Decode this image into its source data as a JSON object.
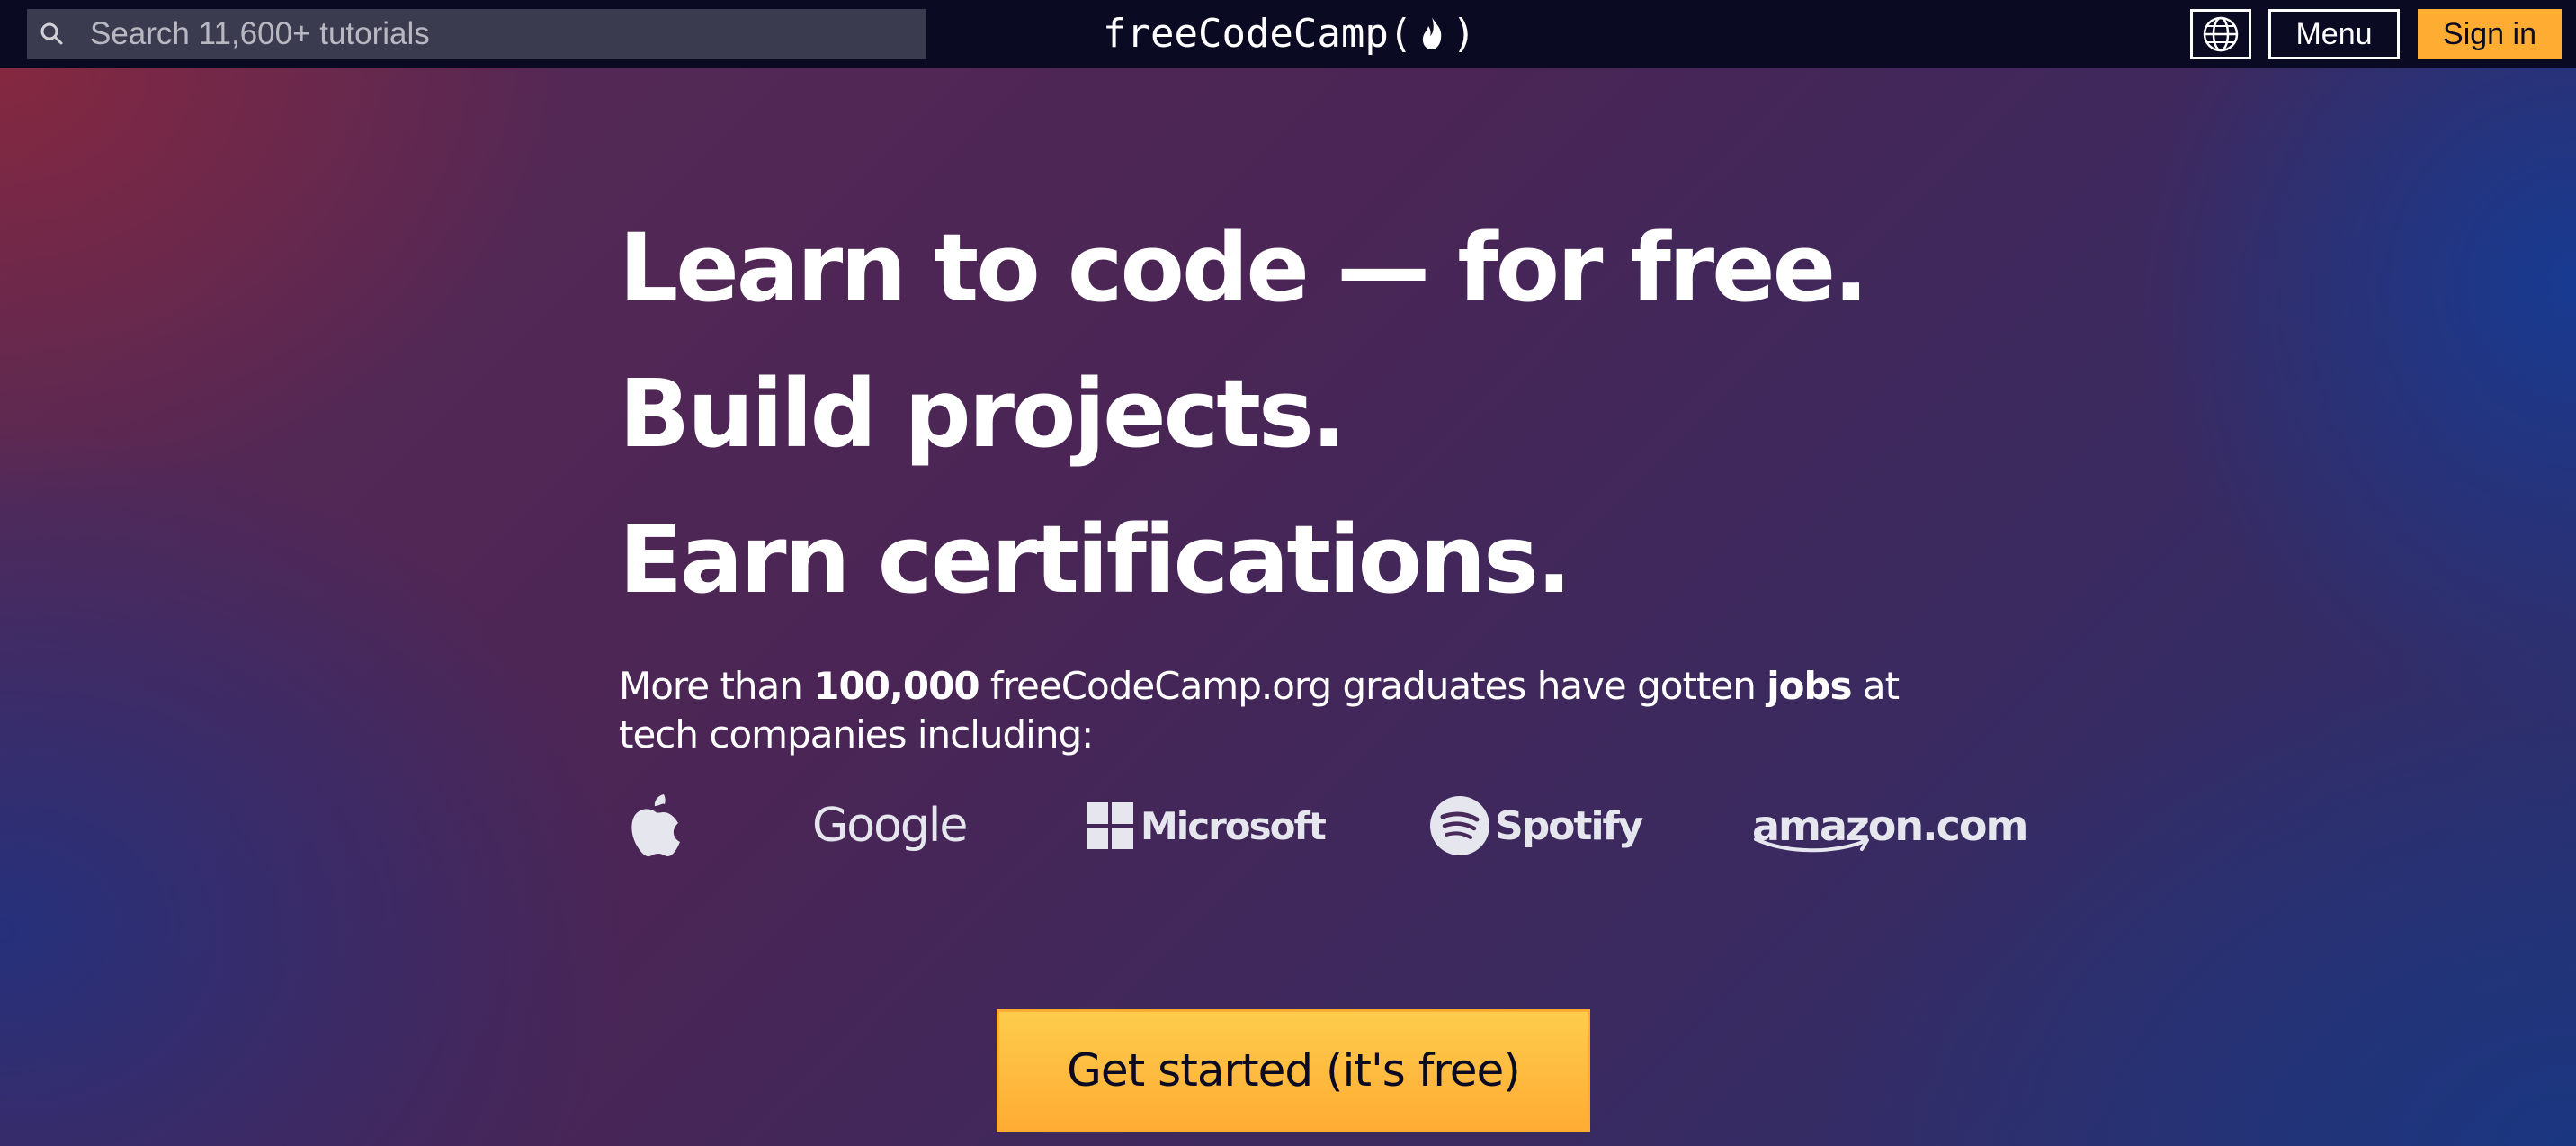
{
  "navbar": {
    "search": {
      "placeholder": "Search 11,600+ tutorials",
      "icon": "search-icon"
    },
    "logo": {
      "text_before": "freeCodeCamp(",
      "text_after": ")",
      "icon": "flame-icon"
    },
    "language_icon": "globe-icon",
    "menu_label": "Menu",
    "signin_label": "Sign in"
  },
  "hero": {
    "headlines": [
      "Learn to code — for free.",
      "Build projects.",
      "Earn certifications."
    ],
    "subtext": {
      "part1": "More than ",
      "count": "100,000",
      "part2": " freeCodeCamp.org graduates have gotten ",
      "jobs": "jobs",
      "part3": " at tech companies including:"
    },
    "companies": {
      "apple": "apple-icon",
      "google": "Google",
      "microsoft": "Microsoft",
      "spotify": "Spotify",
      "amazon": "amazon.com"
    },
    "cta_label": "Get started (it's free)"
  },
  "colors": {
    "navbar_bg": "#0a0a23",
    "search_bg": "#3b3b4f",
    "accent": "#feac32",
    "text_light": "#ffffff"
  }
}
